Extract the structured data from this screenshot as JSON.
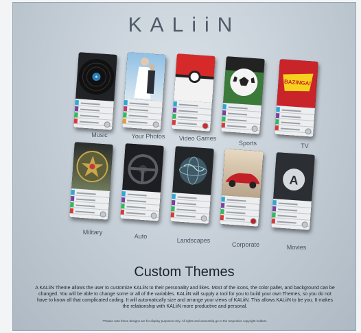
{
  "brand": {
    "logo_text": "KALiiN"
  },
  "themes": [
    {
      "label": "Music",
      "icon": "vinyl-record"
    },
    {
      "label": "Your Photos",
      "icon": "wedding-photo"
    },
    {
      "label": "Video Games",
      "icon": "pokeball"
    },
    {
      "label": "Sports",
      "icon": "soccer-ball"
    },
    {
      "label": "TV",
      "icon": "bazinga-logo"
    },
    {
      "label": "Military",
      "icon": "military-emblem"
    },
    {
      "label": "Auto",
      "icon": "steering-wheel"
    },
    {
      "label": "Landscapes",
      "icon": "globe"
    },
    {
      "label": "Corporate",
      "icon": "red-car"
    },
    {
      "label": "Movies",
      "icon": "letter-a"
    }
  ],
  "tv_badge_text": "BAZINGA!",
  "movies_badge_text": "A",
  "accent_colors": [
    "#2aa9d6",
    "#7b3fa0",
    "#2dbb5b",
    "#d83a3a",
    "#e0e3e6"
  ],
  "heading": "Custom Themes",
  "paragraph": "A KALiiN Theme allows the user to customize KALiiN to their personality and likes. Most of the icons, the color pallet, and background can be changed. You will be able to change some or all of the variables. KALiiN will supply a tool for you to build your own Themes, so you do not have to know all that complicated coding. It will automatically size and arrange your views of KALiiN. This allows KALiiN to be you. It makes the relationship with KALiiN more productive and personal.",
  "footnote": "*Please note these designs are for display purposes only. All rights and ownership go to the respective copyright holders."
}
